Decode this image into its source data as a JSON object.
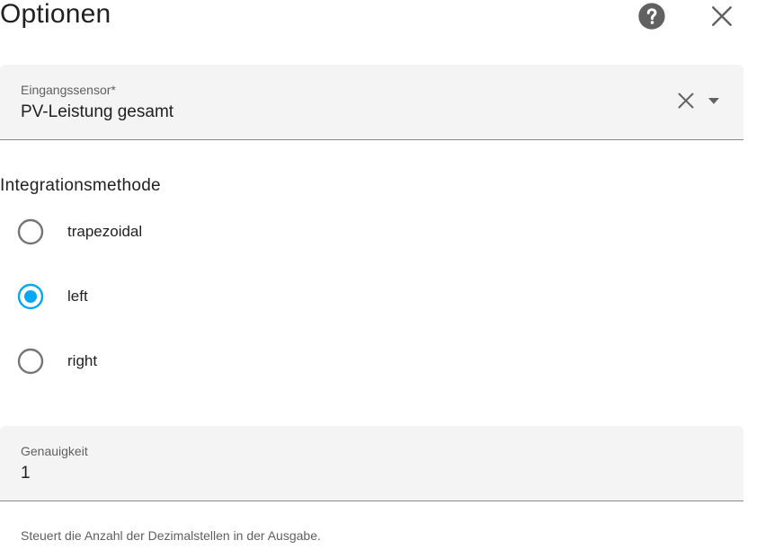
{
  "dialog": {
    "title": "Optionen",
    "help_icon": "help-circle-icon",
    "close_icon": "close-icon"
  },
  "sensor_field": {
    "label": "Eingangssensor*",
    "value": "PV-Leistung gesamt",
    "clear_icon": "clear-icon",
    "dropdown_icon": "dropdown-arrow-icon"
  },
  "integration": {
    "label": "Integrationsmethode",
    "options": [
      {
        "label": "trapezoidal",
        "selected": false
      },
      {
        "label": "left",
        "selected": true
      },
      {
        "label": "right",
        "selected": false
      }
    ]
  },
  "precision_field": {
    "label": "Genauigkeit",
    "value": "1",
    "helper": "Steuert die Anzahl der Dezimalstellen in der Ausgabe."
  },
  "colors": {
    "accent": "#03a9f4",
    "radio_unselected": "#757575",
    "field_background": "#f4f4f4",
    "text_primary": "#212121",
    "text_secondary": "#5f5f5f"
  }
}
